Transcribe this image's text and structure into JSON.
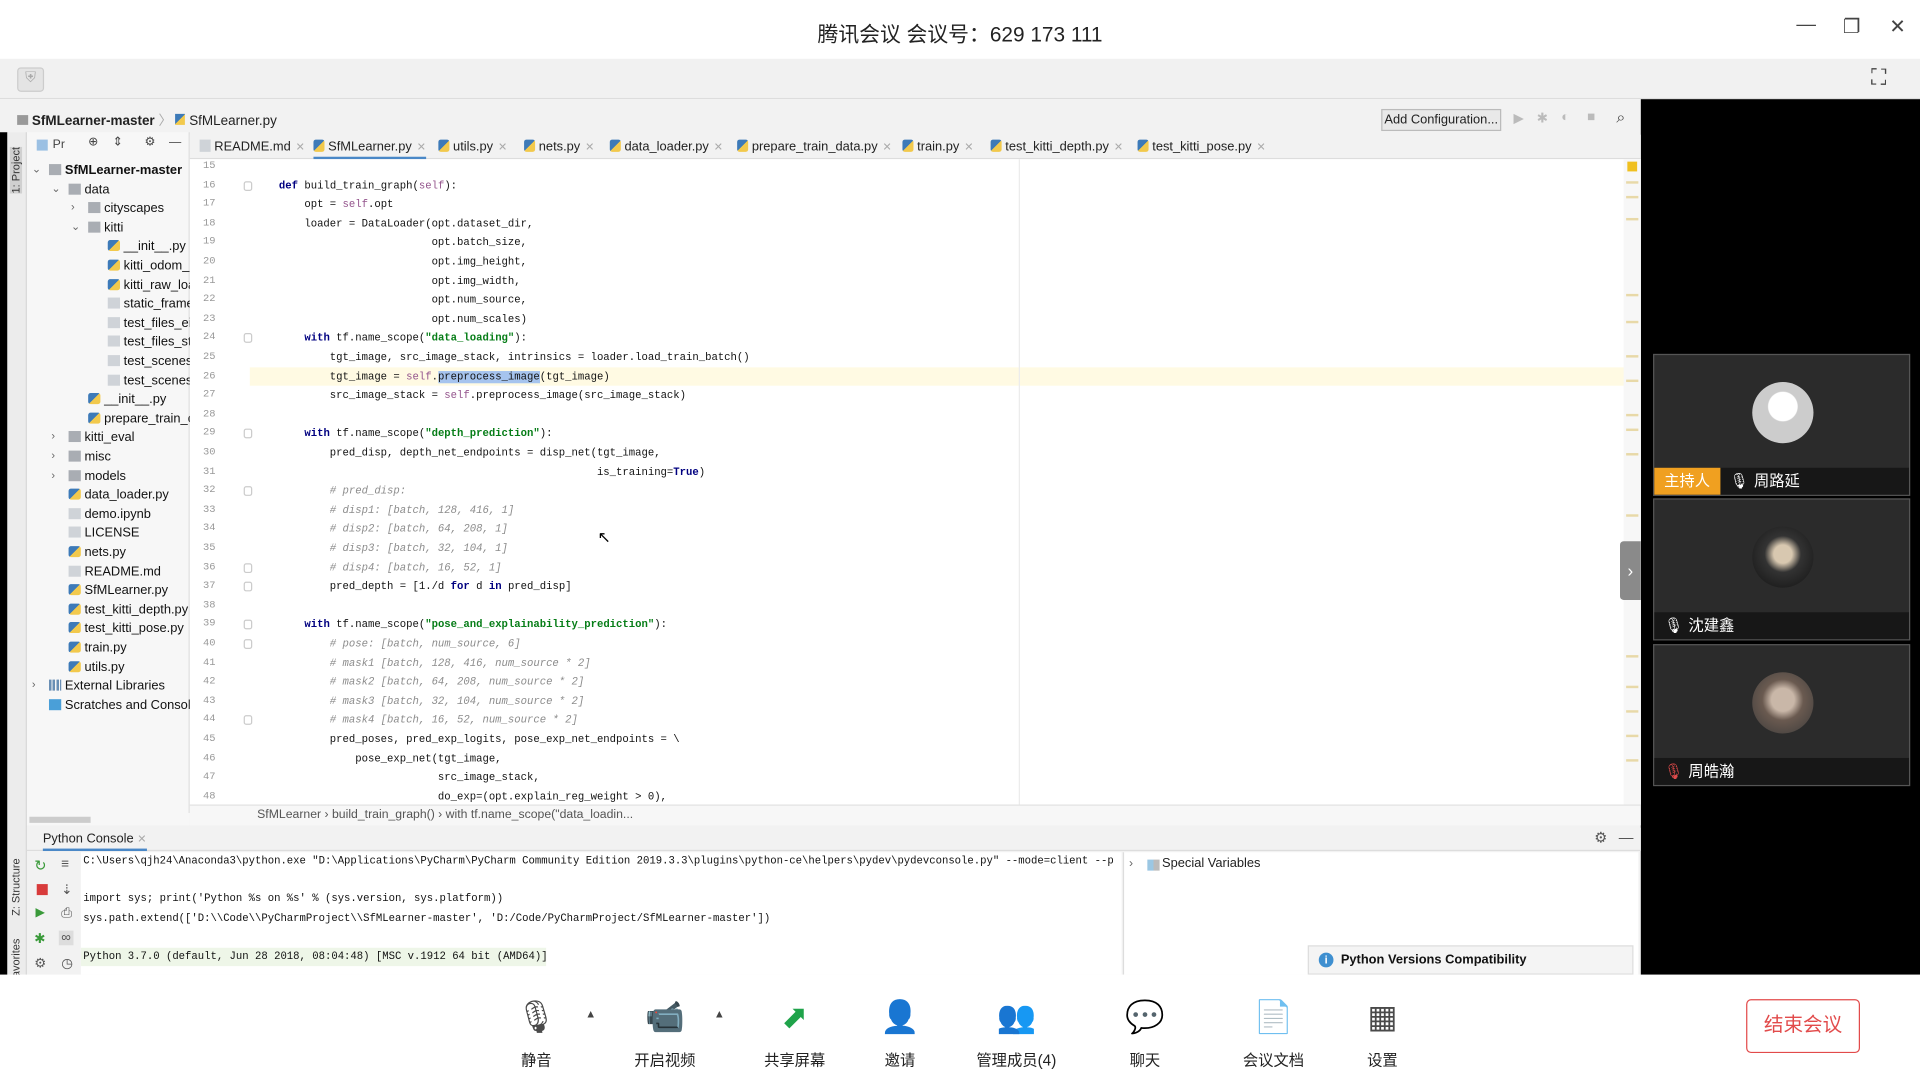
{
  "meeting": {
    "title": "腾讯会议 会议号：629 173 111",
    "minimize": "—",
    "restore": "❐",
    "close": "✕",
    "fullscreen": "⛶",
    "participants": [
      {
        "name": "周路延",
        "role": "主持人",
        "muted": false
      },
      {
        "name": "沈建鑫",
        "muted": false
      },
      {
        "name": "周皓瀚",
        "muted": true
      }
    ],
    "toolbar": [
      {
        "label": "静音",
        "icon": "microphone-icon",
        "glyph": "🎙"
      },
      {
        "label": "开启视频",
        "icon": "camera-off-icon",
        "glyph": "📹"
      },
      {
        "label": "共享屏幕",
        "icon": "share-screen-icon",
        "glyph": "⬈"
      },
      {
        "label": "邀请",
        "icon": "invite-icon",
        "glyph": "👤"
      },
      {
        "label": "管理成员(4)",
        "icon": "members-icon",
        "glyph": "👥"
      },
      {
        "label": "聊天",
        "icon": "chat-icon",
        "glyph": "💬"
      },
      {
        "label": "会议文档",
        "icon": "document-icon",
        "glyph": "📄"
      },
      {
        "label": "设置",
        "icon": "settings-grid-icon",
        "glyph": "▦"
      }
    ],
    "end_label": "结束会议",
    "accent": "#e24b4b",
    "host_color": "#f0a020"
  },
  "ide": {
    "breadcrumb": [
      "SfMLearner-master",
      "SfMLearner.py"
    ],
    "add_config": "Add Configuration...",
    "project_label": "Pr",
    "side_labels": {
      "project": "1: Project",
      "structure": "Z: Structure",
      "favorites": "avorites"
    },
    "tree": [
      {
        "name": "SfMLearner-master",
        "level": 0,
        "type": "folder",
        "open": true,
        "bold": true
      },
      {
        "name": "data",
        "level": 1,
        "type": "folder",
        "open": true
      },
      {
        "name": "cityscapes",
        "level": 2,
        "type": "folder",
        "open": false
      },
      {
        "name": "kitti",
        "level": 2,
        "type": "folder",
        "open": true
      },
      {
        "name": "__init__.py",
        "level": 3,
        "type": "py"
      },
      {
        "name": "kitti_odom_",
        "level": 3,
        "type": "py"
      },
      {
        "name": "kitti_raw_loa",
        "level": 3,
        "type": "py"
      },
      {
        "name": "static_frame",
        "level": 3,
        "type": "file"
      },
      {
        "name": "test_files_eic",
        "level": 3,
        "type": "file"
      },
      {
        "name": "test_files_ste",
        "level": 3,
        "type": "file"
      },
      {
        "name": "test_scenes_",
        "level": 3,
        "type": "file"
      },
      {
        "name": "test_scenes_",
        "level": 3,
        "type": "file"
      },
      {
        "name": "__init__.py",
        "level": 2,
        "type": "py"
      },
      {
        "name": "prepare_train_c",
        "level": 2,
        "type": "py"
      },
      {
        "name": "kitti_eval",
        "level": 1,
        "type": "folder",
        "open": false
      },
      {
        "name": "misc",
        "level": 1,
        "type": "folder",
        "open": false
      },
      {
        "name": "models",
        "level": 1,
        "type": "folder",
        "open": false
      },
      {
        "name": "data_loader.py",
        "level": 1,
        "type": "py"
      },
      {
        "name": "demo.ipynb",
        "level": 1,
        "type": "file"
      },
      {
        "name": "LICENSE",
        "level": 1,
        "type": "file"
      },
      {
        "name": "nets.py",
        "level": 1,
        "type": "py"
      },
      {
        "name": "README.md",
        "level": 1,
        "type": "file"
      },
      {
        "name": "SfMLearner.py",
        "level": 1,
        "type": "py"
      },
      {
        "name": "test_kitti_depth.py",
        "level": 1,
        "type": "py"
      },
      {
        "name": "test_kitti_pose.py",
        "level": 1,
        "type": "py"
      },
      {
        "name": "train.py",
        "level": 1,
        "type": "py"
      },
      {
        "name": "utils.py",
        "level": 1,
        "type": "py"
      },
      {
        "name": "External Libraries",
        "level": 0,
        "type": "lib",
        "open": false
      },
      {
        "name": "Scratches and Console",
        "level": 0,
        "type": "scratch"
      }
    ],
    "tabs": [
      "README.md",
      "SfMLearner.py",
      "utils.py",
      "nets.py",
      "data_loader.py",
      "prepare_train_data.py",
      "train.py",
      "test_kitti_depth.py",
      "test_kitti_pose.py"
    ],
    "active_tab": 1,
    "first_line": 15,
    "highlight_line": 26,
    "selection": "preprocess_image",
    "code": [
      "",
      "    def build_train_graph(self):",
      "        opt = self.opt",
      "        loader = DataLoader(opt.dataset_dir,",
      "                            opt.batch_size,",
      "                            opt.img_height,",
      "                            opt.img_width,",
      "                            opt.num_source,",
      "                            opt.num_scales)",
      "        with tf.name_scope(\"data_loading\"):",
      "            tgt_image, src_image_stack, intrinsics = loader.load_train_batch()",
      "            tgt_image = self.preprocess_image(tgt_image)",
      "            src_image_stack = self.preprocess_image(src_image_stack)",
      "",
      "        with tf.name_scope(\"depth_prediction\"):",
      "            pred_disp, depth_net_endpoints = disp_net(tgt_image,",
      "                                                      is_training=True)",
      "            # pred_disp:",
      "            # disp1: [batch, 128, 416, 1]",
      "            # disp2: [batch, 64, 208, 1]",
      "            # disp3: [batch, 32, 104, 1]",
      "            # disp4: [batch, 16, 52, 1]",
      "            pred_depth = [1./d for d in pred_disp]",
      "",
      "        with tf.name_scope(\"pose_and_explainability_prediction\"):",
      "            # pose: [batch, num_source, 6]",
      "            # mask1 [batch, 128, 416, num_source * 2]",
      "            # mask2 [batch, 64, 208, num_source * 2]",
      "            # mask3 [batch, 32, 104, num_source * 2]",
      "            # mask4 [batch, 16, 52, num_source * 2]",
      "            pred_poses, pred_exp_logits, pose_exp_net_endpoints = \\",
      "                pose_exp_net(tgt_image,",
      "                             src_image_stack,",
      "                             do_exp=(opt.explain_reg_weight > 0),"
    ],
    "editor_breadcrumb": "SfMLearner  ›  build_train_graph()  ›  with tf.name_scope(\"data_loadin...",
    "console": {
      "tab": "Python Console",
      "lines": [
        "C:\\Users\\qjh24\\Anaconda3\\python.exe \"D:\\Applications\\PyCharm\\PyCharm Community Edition 2019.3.3\\plugins\\python-ce\\helpers\\pydev\\pydevconsole.py\" --mode=client --p",
        "import sys; print('Python %s on %s' % (sys.version, sys.platform))",
        "sys.path.extend(['D:\\\\Code\\\\PyCharmProject\\\\SfMLearner-master', 'D:/Code/PyCharmProject/SfMLearner-master'])",
        "Python 3.7.0 (default, Jun 28 2018, 08:04:48) [MSC v.1912 64 bit (AMD64)]"
      ],
      "special_variables": "Special Variables",
      "notification": "Python Versions Compatibility"
    }
  }
}
